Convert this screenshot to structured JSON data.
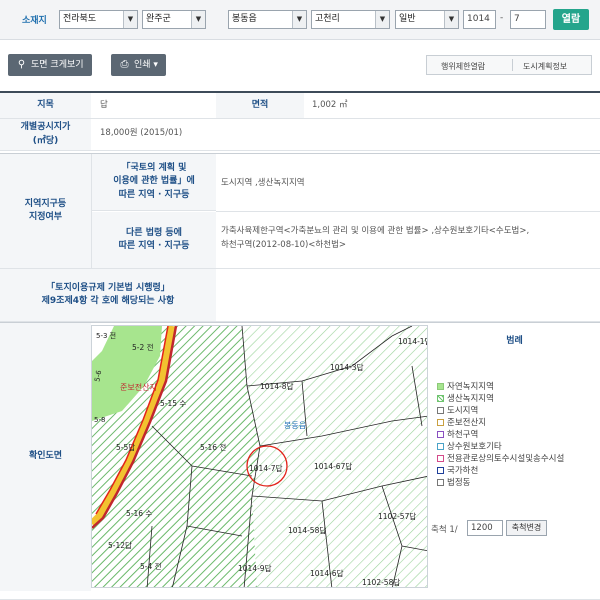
{
  "search": {
    "label": "소재지",
    "province": "전라북도",
    "county": "완주군",
    "town": "봉동읍",
    "village": "고천리",
    "land_type": "일반",
    "main_number": "1014",
    "sub_number": "7",
    "dash": "-",
    "view_button": "열람"
  },
  "toolbar": {
    "enlarge_label": "도면 크게보기",
    "print_label": "인쇄 ▾",
    "restriction_label": "행위제한열람",
    "urban_plan_label": "도시계획정보"
  },
  "table": {
    "jimok_header": "지목",
    "jimok_value": "답",
    "area_header": "면적",
    "area_value": "1,002 ㎡",
    "price_header": "개별공시지가\n(㎡당)",
    "price_value": "18,000원 (2015/01)",
    "zone_header": "지역지구등\n지정여부",
    "law1_header": "「국토의 계획 및\n이용에 관한 법률」에\n따른 지역 · 지구등",
    "law1_value": "도시지역 ,생산녹지지역",
    "law2_header": "다른 법령 등에\n따른 지역 · 지구등",
    "law2_value": "가축사육제한구역<가축분뇨의 관리 및 이용에 관한 법률> ,상수원보호기타<수도법>,\n하천구역(2012-08-10)<하천법>",
    "rule_header": "「토지이용규제 기본법 시행령」\n제9조제4항 각 호에 해당되는 사항",
    "rule_value": "",
    "map_header": "확인도면"
  },
  "map": {
    "labels": [
      "5-2 전",
      "5-15 수",
      "5-5답",
      "5-16 전",
      "5-16 수",
      "5-12답",
      "5-4 전",
      "1014-8답",
      "1014-3답",
      "1014-1답",
      "1014-7답",
      "1014-67답",
      "1102-57답",
      "1014-58답",
      "1014-9답",
      "1014-6답",
      "1102-58답",
      "봉동읍",
      "준보전산지",
      "5-6",
      "5-3 전",
      "5-8"
    ],
    "colors": {
      "green_fill": "#9be08a",
      "hatch": "#5aa85a",
      "red_line": "#e2231a",
      "river": "#c1272d",
      "forest_band": "#f2c230"
    }
  },
  "legend": {
    "title": "범례",
    "items": [
      {
        "label": "자연녹지지역",
        "color": "#a6e58f"
      },
      {
        "label": "생산녹지지역",
        "color": "#6fc46f"
      },
      {
        "label": "도시지역",
        "color": "#ffffff"
      },
      {
        "label": "준보전산지",
        "color": "#ffffff"
      },
      {
        "label": "하천구역",
        "color": "#ffffff"
      },
      {
        "label": "상수원보호기타",
        "color": "#ffffff"
      },
      {
        "label": "전용관로상의토수시설및송수시설",
        "color": "#ffffff"
      },
      {
        "label": "국가하천",
        "color": "#ffffff"
      },
      {
        "label": "법정동",
        "color": "#ffffff"
      }
    ],
    "scale_label": "축척 1/",
    "scale_value": "1200",
    "scale_button": "축척변경"
  }
}
